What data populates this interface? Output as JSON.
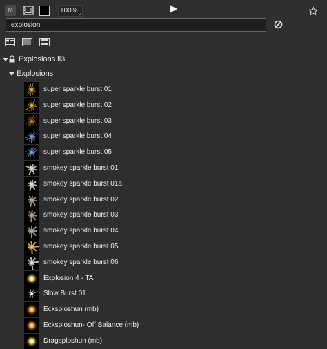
{
  "toolbar": {
    "m_label": "M",
    "zoom": "100%"
  },
  "search": {
    "value": "explosion",
    "placeholder": ""
  },
  "tree": {
    "library": "Explosions.il3",
    "folder": "Explosions"
  },
  "items": [
    {
      "label": "super sparkle burst 01",
      "thumb": "sparkle-gold"
    },
    {
      "label": "super sparkle burst 02",
      "thumb": "sparkle-gold"
    },
    {
      "label": "super sparkle burst 03",
      "thumb": "sparkle-dark"
    },
    {
      "label": "super sparkle burst 04",
      "thumb": "sparkle-blue"
    },
    {
      "label": "super sparkle burst 05",
      "thumb": "sparkle-blue"
    },
    {
      "label": "smokey sparkle burst 01",
      "thumb": "smoke-white"
    },
    {
      "label": "smokey sparkle burst 01a",
      "thumb": "smoke-white"
    },
    {
      "label": "smokey sparkle burst 02",
      "thumb": "smoke-dark"
    },
    {
      "label": "smokey sparkle burst 03",
      "thumb": "smoke-dark"
    },
    {
      "label": "smokey sparkle burst 04",
      "thumb": "smoke-dark"
    },
    {
      "label": "smokey sparkle burst 05",
      "thumb": "smoke-gold"
    },
    {
      "label": "smokey sparkle burst 06",
      "thumb": "smoke-white"
    },
    {
      "label": "Explosion 4 - TA",
      "thumb": "orb-yellow"
    },
    {
      "label": "Slow Burst 01",
      "thumb": "burst-white"
    },
    {
      "label": "Ecksploshun (mb)",
      "thumb": "orb-orange"
    },
    {
      "label": "Ecksploshun- Off Balance (mb)",
      "thumb": "orb-orange"
    },
    {
      "label": "Dragsploshun (mb)",
      "thumb": "orb-yellow"
    }
  ],
  "thumb_colors": {
    "sparkle-gold": "#e8b040",
    "sparkle-dark": "#b07a30",
    "sparkle-blue": "#7fa6d8",
    "smoke-white": "#e6dccb",
    "smoke-dark": "#b8a690",
    "smoke-gold": "#f0c060",
    "orb-yellow": "#ffe060",
    "burst-white": "#f4f0e4",
    "orb-orange": "#ff9a30"
  },
  "icons": {
    "film": "film-icon",
    "play": "play-icon",
    "star": "star-icon",
    "clear": "clear-search-icon",
    "view1": "list-detail-view-icon",
    "view2": "list-view-icon",
    "view3": "grid-view-icon",
    "lock": "lock-icon"
  }
}
